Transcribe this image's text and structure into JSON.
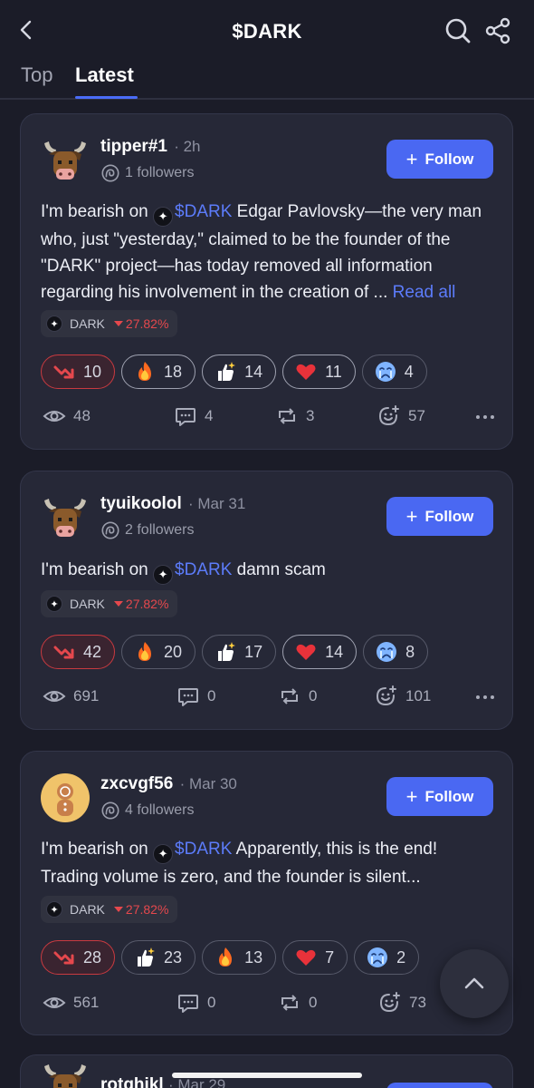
{
  "header": {
    "title": "$DARK"
  },
  "tabs": [
    {
      "label": "Top"
    },
    {
      "label": "Latest"
    }
  ],
  "colors": {
    "accent": "#4a68f2",
    "bearish": "#e5484d",
    "background": "#1b1c28",
    "card": "#262837"
  },
  "posts": [
    {
      "username": "tipper#1",
      "time": "· 2h",
      "followers": "1 followers",
      "follow_label": "Follow",
      "text_prefix": "I'm bearish on",
      "ticker": "$DARK",
      "text_body": "Edgar Pavlovsky—the very man who, just \"yesterday,\" claimed to be the founder of the \"DARK\" project—has today removed all information regarding his involvement in the creation of ...",
      "read_all": "Read all",
      "token": {
        "name": "DARK",
        "change": "27.82%"
      },
      "reactions": [
        {
          "icon": "bearish-arrow-icon",
          "count": "10"
        },
        {
          "icon": "fire-icon",
          "count": "18"
        },
        {
          "icon": "thumbs-up-icon",
          "count": "14"
        },
        {
          "icon": "heart-icon",
          "count": "11"
        },
        {
          "icon": "crying-face-icon",
          "count": "4"
        }
      ],
      "stats": {
        "views": "48",
        "comments": "4",
        "reposts": "3",
        "reacts": "57"
      }
    },
    {
      "username": "tyuikoolol",
      "time": "· Mar 31",
      "followers": "2 followers",
      "follow_label": "Follow",
      "text_prefix": "I'm bearish on",
      "ticker": "$DARK",
      "text_body": "damn scam",
      "token": {
        "name": "DARK",
        "change": "27.82%"
      },
      "reactions": [
        {
          "icon": "bearish-arrow-icon",
          "count": "42"
        },
        {
          "icon": "fire-icon",
          "count": "20"
        },
        {
          "icon": "thumbs-up-icon",
          "count": "17"
        },
        {
          "icon": "heart-icon",
          "count": "14"
        },
        {
          "icon": "crying-face-icon",
          "count": "8"
        }
      ],
      "stats": {
        "views": "691",
        "comments": "0",
        "reposts": "0",
        "reacts": "101"
      }
    },
    {
      "username": "zxcvgf56",
      "time": "· Mar 30",
      "followers": "4 followers",
      "follow_label": "Follow",
      "text_prefix": "I'm bearish on",
      "ticker": "$DARK",
      "text_body": "Apparently, this is the end! Trading volume is zero, and the founder is silent...",
      "token": {
        "name": "DARK",
        "change": "27.82%"
      },
      "reactions": [
        {
          "icon": "bearish-arrow-icon",
          "count": "28"
        },
        {
          "icon": "thumbs-up-icon",
          "count": "23"
        },
        {
          "icon": "fire-icon",
          "count": "13"
        },
        {
          "icon": "heart-icon",
          "count": "7"
        },
        {
          "icon": "crying-face-icon",
          "count": "2"
        }
      ],
      "stats": {
        "views": "561",
        "comments": "0",
        "reposts": "0",
        "reacts": "73"
      }
    }
  ],
  "next_post": {
    "username": "rotghikl",
    "time": "· Mar 29"
  }
}
